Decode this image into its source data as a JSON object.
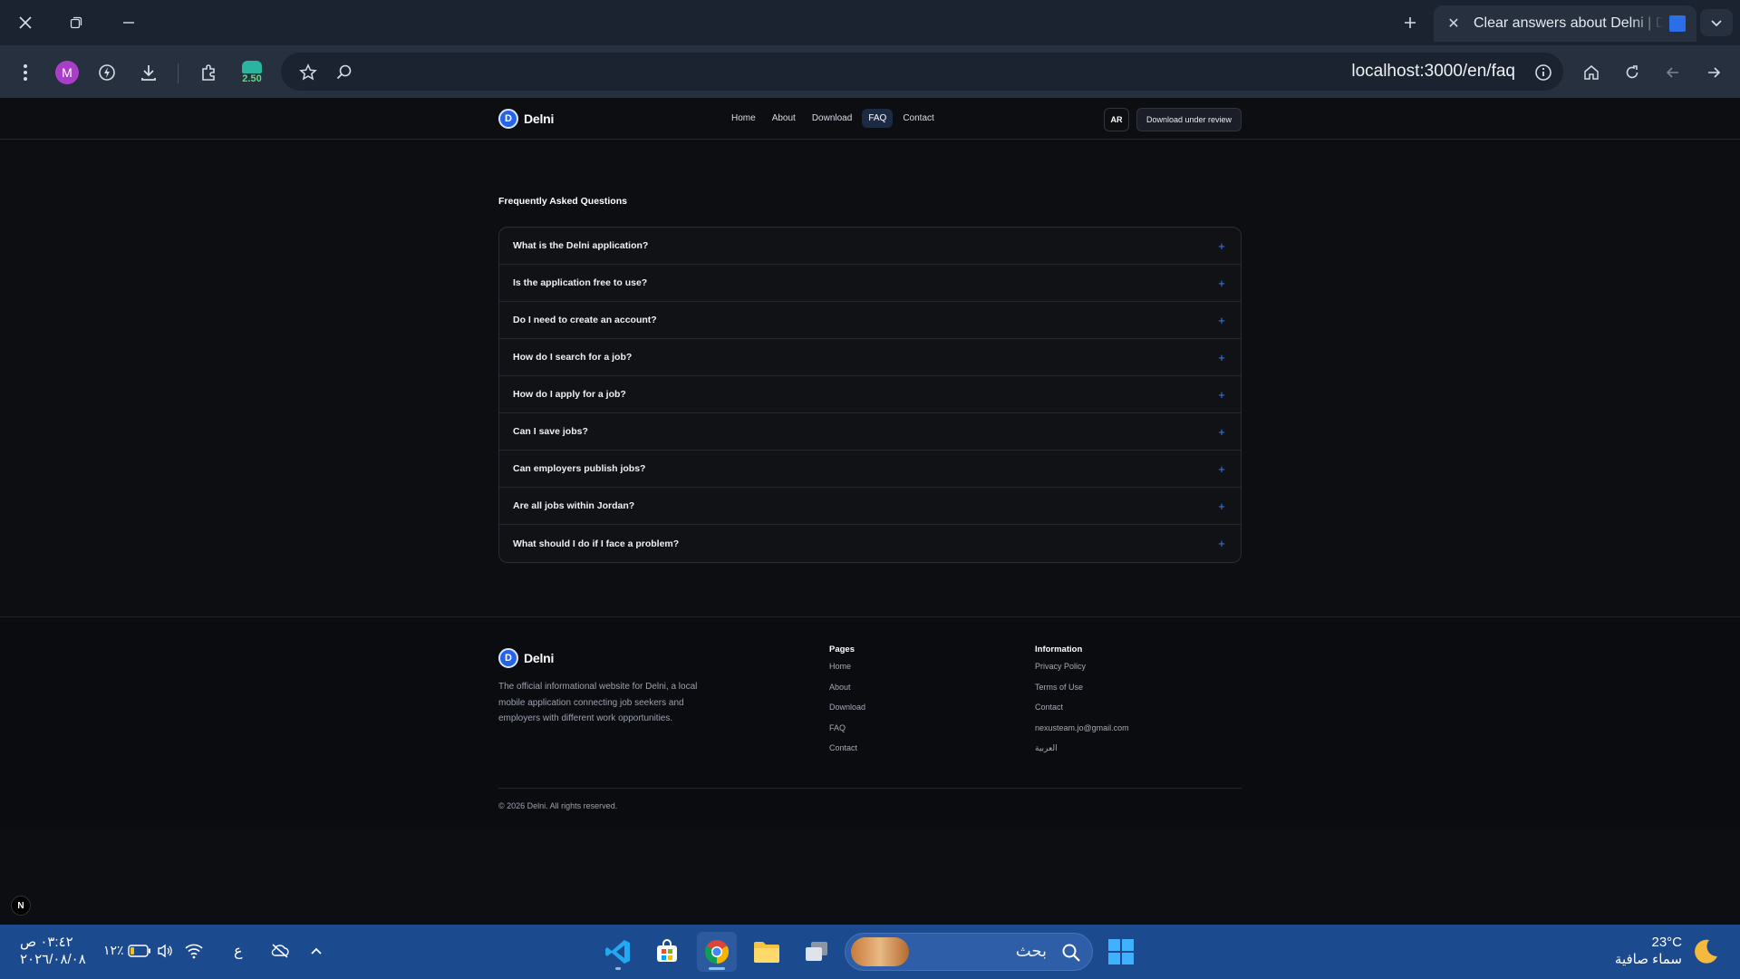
{
  "browser": {
    "tab_title": "Clear answers about Delni | Delni",
    "url": "localhost:3000/en/faq",
    "profile_initial": "M",
    "extension_badge": "2.50"
  },
  "site": {
    "brand": "Delni",
    "logo_letter": "D",
    "nav": [
      {
        "label": "Home"
      },
      {
        "label": "About"
      },
      {
        "label": "Download"
      },
      {
        "label": "FAQ",
        "active": true
      },
      {
        "label": "Contact"
      }
    ],
    "lang_button": "AR",
    "download_button": "Download under review"
  },
  "faq": {
    "title": "Frequently Asked Questions",
    "items": [
      "What is the Delni application?",
      "Is the application free to use?",
      "Do I need to create an account?",
      "How do I search for a job?",
      "How do I apply for a job?",
      "Can I save jobs?",
      "Can employers publish jobs?",
      "Are all jobs within Jordan?",
      "What should I do if I face a problem?"
    ],
    "expand_symbol": "+"
  },
  "footer": {
    "description": "The official informational website for Delni, a local mobile application connecting job seekers and employers with different work opportunities.",
    "pages_heading": "Pages",
    "pages": [
      "Home",
      "About",
      "Download",
      "FAQ",
      "Contact"
    ],
    "info_heading": "Information",
    "info": [
      "Privacy Policy",
      "Terms of Use",
      "Contact",
      "nexusteam.jo@gmail.com",
      "العربية"
    ],
    "copyright": "© 2026 Delni. All rights reserved."
  },
  "dev_badge": "N",
  "taskbar": {
    "search_placeholder": "بحث",
    "weather_temp": "23°C",
    "weather_desc": "سماء صافية",
    "time": "٠٣:٤٢ ص",
    "date": "٢٠٢٦/٠٨/٠٨",
    "battery": "١٢٪",
    "input_lang": "ع"
  },
  "colors": {
    "accent": "#2563eb",
    "page_bg": "#0d0e12",
    "taskbar_bg": "#1c4a8e"
  }
}
